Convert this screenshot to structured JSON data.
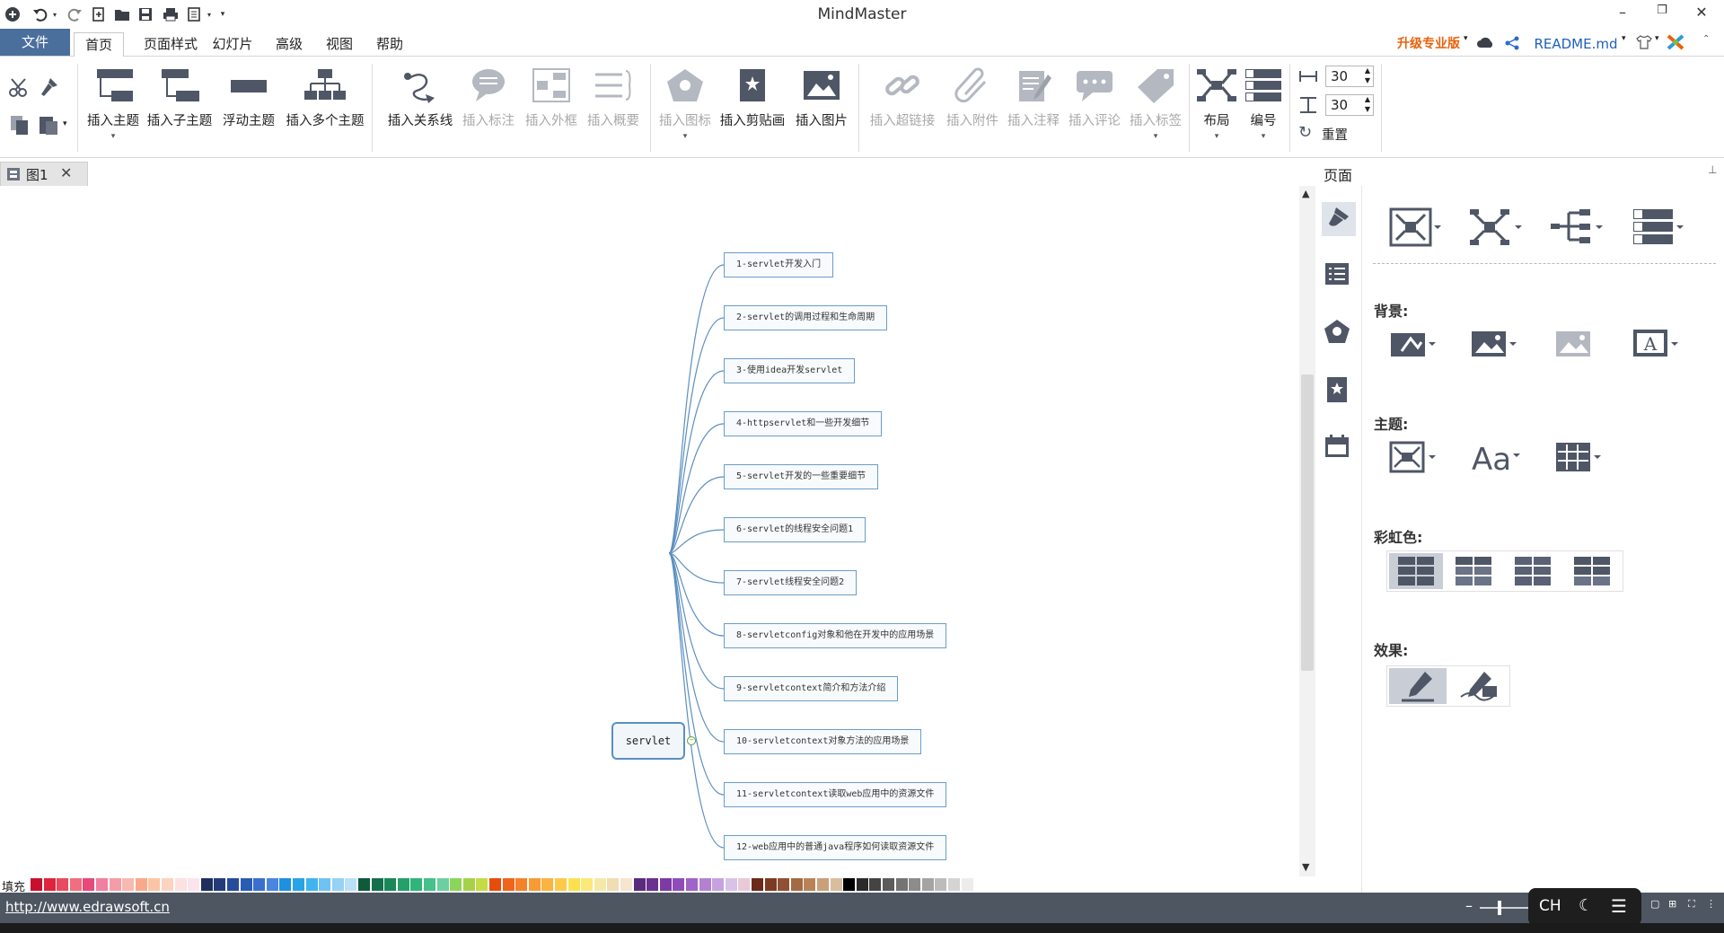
{
  "window": {
    "title": "MindMaster",
    "minimize": "–",
    "restore": "❐",
    "close": "✕"
  },
  "menu": {
    "file": "文件",
    "tabs": [
      "首页",
      "页面样式",
      "幻灯片",
      "高级",
      "视图",
      "帮助"
    ],
    "upgrade": "升级专业版",
    "readme": "README.md"
  },
  "ribbon": {
    "insert_topic": "插入主题",
    "insert_subtopic": "插入子主题",
    "floating_topic": "浮动主题",
    "insert_multiple": "插入多个主题",
    "insert_relationship": "插入关系线",
    "insert_callout": "插入标注",
    "insert_boundary": "插入外框",
    "insert_summary": "插入概要",
    "insert_icon": "插入图标",
    "insert_clipart": "插入剪贴画",
    "insert_image": "插入图片",
    "insert_hyperlink": "插入超链接",
    "insert_attachment": "插入附件",
    "insert_note": "插入注释",
    "insert_comment": "插入评论",
    "insert_tag": "插入标签",
    "layout": "布局",
    "numbering": "编号",
    "spacing_h": "30",
    "spacing_v": "30",
    "reset": "重置"
  },
  "doc_tab": {
    "label": "图1",
    "close": "✕"
  },
  "panel": {
    "title": "页面",
    "background_label": "背景:",
    "theme_label": "主题:",
    "rainbow_label": "彩虹色:",
    "effect_label": "效果:"
  },
  "mindmap": {
    "central": "servlet",
    "topics": [
      "1-servlet开发入门",
      "2-servlet的调用过程和生命周期",
      "3-使用idea开发servlet",
      "4-httpservlet和一些开发细节",
      "5-servlet开发的一些重要细节",
      "6-servlet的线程安全问题1",
      "7-servlet线程安全问题2",
      "8-servletconfig对象和他在开发中的应用场景",
      "9-servletcontext简介和方法介绍",
      "10-servletcontext对象方法的应用场景",
      "11-servletcontext读取web应用中的资源文件",
      "12-web应用中的普通java程序如何读取资源文件"
    ]
  },
  "palette": {
    "label": "填充",
    "colors": [
      "#c8102e",
      "#e0243c",
      "#e84a5f",
      "#ef6f7f",
      "#e8487a",
      "#f07fa0",
      "#f59ca8",
      "#f7b9b0",
      "#f9a98a",
      "#fbc5a5",
      "#fcd2c0",
      "#fde0e0",
      "#fbe4ee",
      "#1f2f5c",
      "#243b7a",
      "#274a9b",
      "#2a5cb5",
      "#3a6fcf",
      "#4a86e0",
      "#1e90e0",
      "#29a3e8",
      "#40b4ee",
      "#6ec3f2",
      "#95d2f5",
      "#b9e1f8",
      "#0e5a3a",
      "#13704a",
      "#1a8758",
      "#24a06a",
      "#2fb47c",
      "#46c18b",
      "#6ccf9f",
      "#8bd65a",
      "#a6d24a",
      "#c3dc45",
      "#e84c0c",
      "#f0651a",
      "#f5822a",
      "#f89b35",
      "#fbb43f",
      "#fdc94a",
      "#fde04f",
      "#fbe97a",
      "#f5e9a8",
      "#f1dcb4",
      "#f6e6cf",
      "#5a2b7a",
      "#6b2f8f",
      "#7d3aa5",
      "#8f4cb8",
      "#a063c7",
      "#b481d2",
      "#c7a2de",
      "#d9c2e8",
      "#e9c8d8",
      "#6b2a1a",
      "#7d3a22",
      "#905033",
      "#a46a44",
      "#b88457",
      "#c9a07a",
      "#d9bd9e",
      "#000000",
      "#2a2a2a",
      "#444444",
      "#5c5c5c",
      "#747474",
      "#8c8c8c",
      "#a4a4a4",
      "#bcbcbc",
      "#d4d4d4",
      "#ececec",
      "#ffffff"
    ]
  },
  "status": {
    "url": "http://www.edrawsoft.cn",
    "zoom_minus": "–",
    "zoom_plus": "+",
    "ime_lang": "CH"
  },
  "colors": {
    "accent": "#4a6f9c",
    "upgrade": "#e8620e",
    "link": "#1f5fbf",
    "statusbar": "#4e5661",
    "icon": "#4f5666",
    "icon_disabled": "#b4b8c0"
  }
}
